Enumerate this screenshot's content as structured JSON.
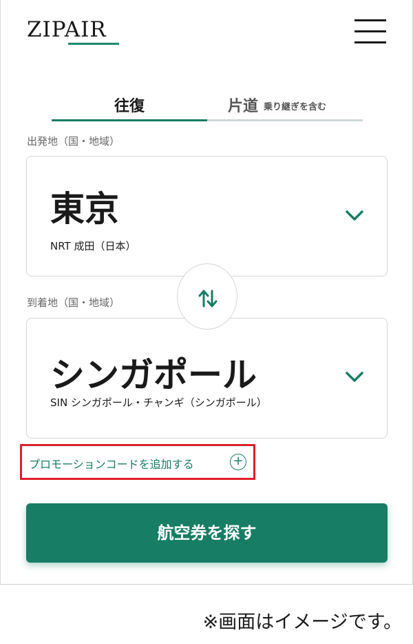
{
  "header": {
    "logo_text": "ZIPAIR",
    "menu_icon": "hamburger-menu-icon"
  },
  "tabs": {
    "roundtrip_label": "往復",
    "oneway_label": "片道",
    "oneway_sub": "乗り継ぎを含む"
  },
  "origin": {
    "label": "出発地（国・地域）",
    "city": "東京",
    "airport": "NRT 成田（日本）"
  },
  "destination": {
    "label": "到着地（国・地域）",
    "city": "シンガポール",
    "airport": "SIN シンガポール・チャンギ（シンガポール）"
  },
  "promo": {
    "link_text": "プロモーションコードを追加する",
    "icon": "plus-circle-icon",
    "plus": "+"
  },
  "search_button": "航空券を探す",
  "footnote": "※画面はイメージです。",
  "colors": {
    "accent": "#177d64",
    "highlight": "#e01e2b"
  }
}
